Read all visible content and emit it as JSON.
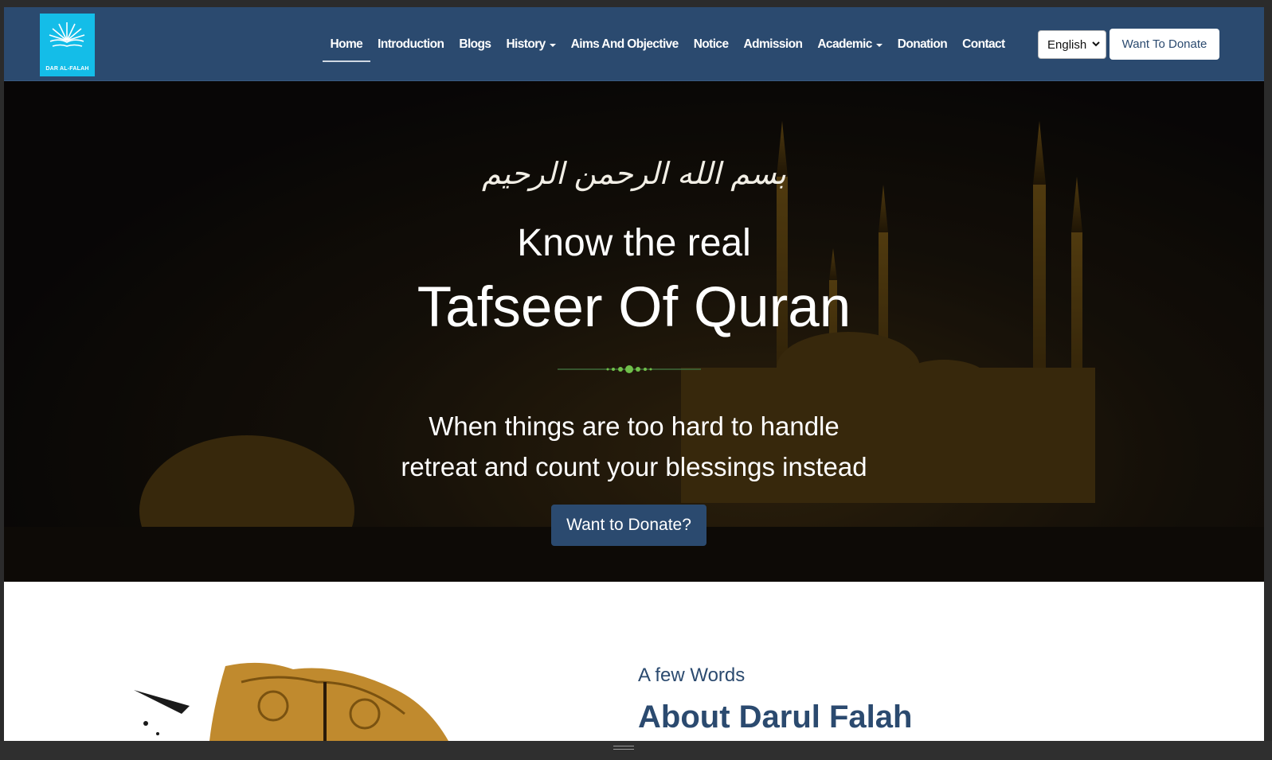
{
  "brand": {
    "logo_text": "DAR AL-FALAH",
    "accent": "#14bde8",
    "primary": "#2b4a6f"
  },
  "nav": {
    "items": [
      {
        "label": "Home",
        "active": true,
        "dropdown": false
      },
      {
        "label": "Introduction",
        "dropdown": false
      },
      {
        "label": "Blogs",
        "dropdown": false
      },
      {
        "label": "History",
        "dropdown": true
      },
      {
        "label": "Aims And Objective",
        "dropdown": false
      },
      {
        "label": "Notice",
        "dropdown": false
      },
      {
        "label": "Admission",
        "dropdown": false
      },
      {
        "label": "Academic",
        "dropdown": true
      },
      {
        "label": "Donation",
        "dropdown": false
      },
      {
        "label": "Contact",
        "dropdown": false
      }
    ],
    "language": "English",
    "donate_label": "Want To Donate"
  },
  "hero": {
    "bismillah": "بسم الله الرحمن الرحيم",
    "line1": "Know the real",
    "line2": "Tafseer Of Quran",
    "quote_line1": "When things are too hard to handle",
    "quote_line2": "retreat and count your blessings instead",
    "button_label": "Want to Donate?"
  },
  "about": {
    "kicker": "A few Words",
    "title": "About Darul Falah"
  }
}
